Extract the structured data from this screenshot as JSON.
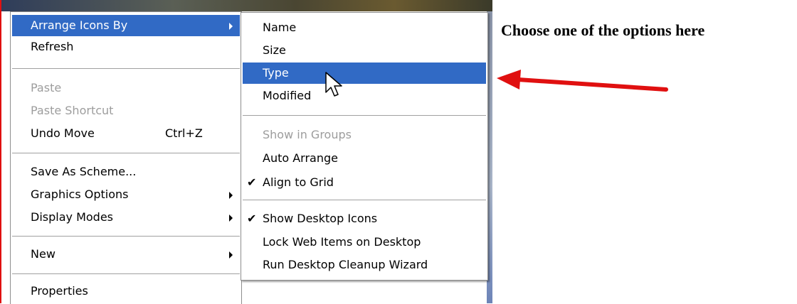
{
  "main_menu": {
    "items": [
      {
        "label": "Arrange Icons By"
      },
      {
        "label": "Refresh"
      },
      {
        "label": "Paste"
      },
      {
        "label": "Paste Shortcut"
      },
      {
        "label": "Undo Move",
        "shortcut": "Ctrl+Z"
      },
      {
        "label": "Save As Scheme..."
      },
      {
        "label": "Graphics Options"
      },
      {
        "label": "Display Modes"
      },
      {
        "label": "New"
      },
      {
        "label": "Properties"
      }
    ]
  },
  "sub_menu": {
    "items": [
      {
        "label": "Name"
      },
      {
        "label": "Size"
      },
      {
        "label": "Type"
      },
      {
        "label": "Modified"
      },
      {
        "label": "Show in Groups"
      },
      {
        "label": "Auto Arrange"
      },
      {
        "label": "Align to Grid",
        "checked": true
      },
      {
        "label": "Show Desktop Icons",
        "checked": true
      },
      {
        "label": "Lock Web Items on Desktop"
      },
      {
        "label": "Run Desktop Cleanup Wizard"
      }
    ],
    "check_glyph": "✔"
  },
  "annotation": {
    "text": "Choose one of the options here",
    "arrow_color": "#e01010"
  },
  "colors": {
    "highlight": "#316ac5",
    "disabled_text": "#9d9d9d"
  }
}
